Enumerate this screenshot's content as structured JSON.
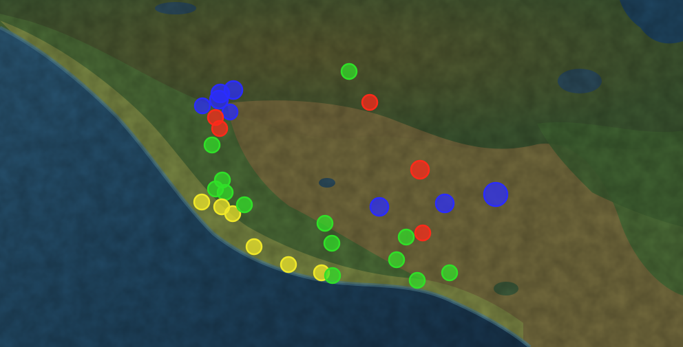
{
  "map": {
    "layer": "satellite",
    "colors": {
      "ocean_deep": "#1a3550",
      "ocean": "#234a66",
      "coast_shallow": "#3c6c82",
      "lowland": "#6f7a3a",
      "highland": "#3e5a2c",
      "dry": "#8a6a3a",
      "lake": "#2b4a5a"
    }
  },
  "legend_colors": {
    "blue": "#2a2cff",
    "red": "#ff2a1a",
    "green": "#30e028",
    "yellow": "#f0e82a"
  },
  "markers": [
    {
      "color": "green",
      "size": "s"
    },
    {
      "color": "red",
      "size": "s"
    },
    {
      "color": "blue",
      "size": "s"
    },
    {
      "color": "blue",
      "size": "m"
    },
    {
      "color": "blue",
      "size": "m"
    },
    {
      "color": "blue",
      "size": "m"
    },
    {
      "color": "blue",
      "size": "s"
    },
    {
      "color": "red",
      "size": "s"
    },
    {
      "color": "red",
      "size": "s"
    },
    {
      "color": "green",
      "size": "s"
    },
    {
      "color": "green",
      "size": "s"
    },
    {
      "color": "green",
      "size": "s"
    },
    {
      "color": "green",
      "size": "s"
    },
    {
      "color": "yellow",
      "size": "s"
    },
    {
      "color": "yellow",
      "size": "s"
    },
    {
      "color": "yellow",
      "size": "s"
    },
    {
      "color": "green",
      "size": "s"
    },
    {
      "color": "red",
      "size": "m"
    },
    {
      "color": "blue",
      "size": "m"
    },
    {
      "color": "blue",
      "size": "m"
    },
    {
      "color": "blue",
      "size": "l"
    },
    {
      "color": "green",
      "size": "s"
    },
    {
      "color": "green",
      "size": "s"
    },
    {
      "color": "green",
      "size": "s"
    },
    {
      "color": "red",
      "size": "s"
    },
    {
      "color": "green",
      "size": "s"
    },
    {
      "color": "green",
      "size": "s"
    },
    {
      "color": "green",
      "size": "s"
    },
    {
      "color": "yellow",
      "size": "s"
    },
    {
      "color": "yellow",
      "size": "s"
    },
    {
      "color": "yellow",
      "size": "s"
    },
    {
      "color": "green",
      "size": "s"
    }
  ]
}
